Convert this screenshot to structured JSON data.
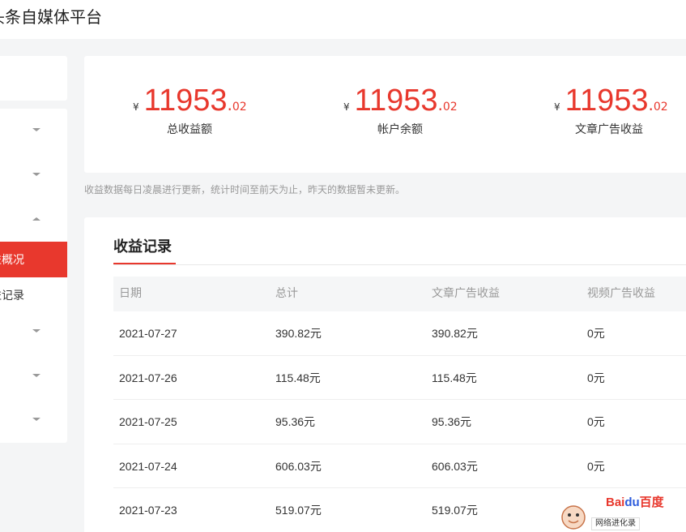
{
  "header": {
    "title": "头条自媒体平台"
  },
  "sidebar": {
    "active_label": "收益概况",
    "record_label": "收益记录"
  },
  "stats": [
    {
      "currency": "¥",
      "integer": "11953",
      "dot": ".",
      "decimal": "02",
      "label": "总收益额"
    },
    {
      "currency": "¥",
      "integer": "11953",
      "dot": ".",
      "decimal": "02",
      "label": "帐户余额"
    },
    {
      "currency": "¥",
      "integer": "11953",
      "dot": ".",
      "decimal": "02",
      "label": "文章广告收益"
    }
  ],
  "notice": "收益数据每日凌晨进行更新，统计时间至前天为止，昨天的数据暂未更新。",
  "records": {
    "title": "收益记录",
    "columns": [
      "日期",
      "总计",
      "文章广告收益",
      "视频广告收益"
    ],
    "rows": [
      [
        "2021-07-27",
        "390.82元",
        "390.82元",
        "0元"
      ],
      [
        "2021-07-26",
        "115.48元",
        "115.48元",
        "0元"
      ],
      [
        "2021-07-25",
        "95.36元",
        "95.36元",
        "0元"
      ],
      [
        "2021-07-24",
        "606.03元",
        "606.03元",
        "0元"
      ],
      [
        "2021-07-23",
        "519.07元",
        "519.07元",
        ""
      ]
    ]
  },
  "watermark": {
    "logo_a": "Bai",
    "logo_b": "du",
    "logo_c": "百度",
    "tag": "网络进化录"
  },
  "colors": {
    "accent": "#e8382d",
    "background": "#f4f5f6"
  }
}
